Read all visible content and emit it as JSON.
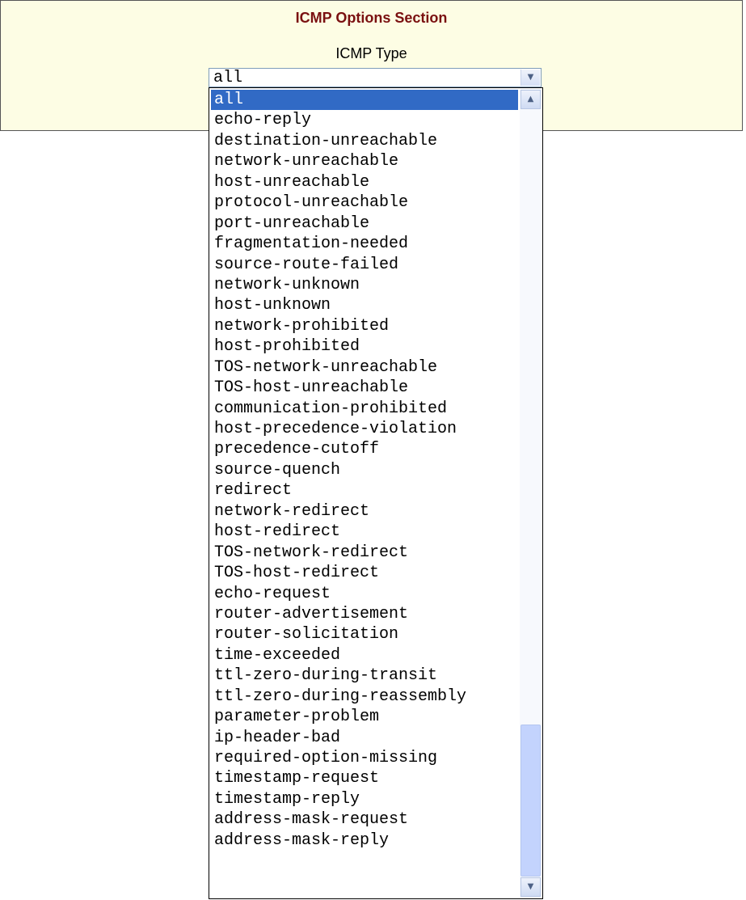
{
  "section": {
    "title": "ICMP Options Section",
    "field_label": "ICMP Type"
  },
  "select": {
    "value": "all",
    "arrow_icon": "chevron-down-icon"
  },
  "dropdown": {
    "selected_index": 0,
    "options": [
      "all",
      "echo-reply",
      "destination-unreachable",
      "network-unreachable",
      "host-unreachable",
      "protocol-unreachable",
      "port-unreachable",
      "fragmentation-needed",
      "source-route-failed",
      "network-unknown",
      "host-unknown",
      "network-prohibited",
      "host-prohibited",
      "TOS-network-unreachable",
      "TOS-host-unreachable",
      "communication-prohibited",
      "host-precedence-violation",
      "precedence-cutoff",
      "source-quench",
      "redirect",
      "network-redirect",
      "host-redirect",
      "TOS-network-redirect",
      "TOS-host-redirect",
      "echo-request",
      "router-advertisement",
      "router-solicitation",
      "time-exceeded",
      "ttl-zero-during-transit",
      "ttl-zero-during-reassembly",
      "parameter-problem",
      "ip-header-bad",
      "required-option-missing",
      "timestamp-request",
      "timestamp-reply",
      "address-mask-request",
      "address-mask-reply"
    ],
    "scroll": {
      "up_icon": "chevron-up-icon",
      "down_icon": "chevron-down-icon"
    }
  },
  "colors": {
    "panel_background": "#fdfde4",
    "title_color": "#7a1010",
    "selected_background": "#316ac5",
    "scroll_thumb": "#c3d3fd"
  }
}
